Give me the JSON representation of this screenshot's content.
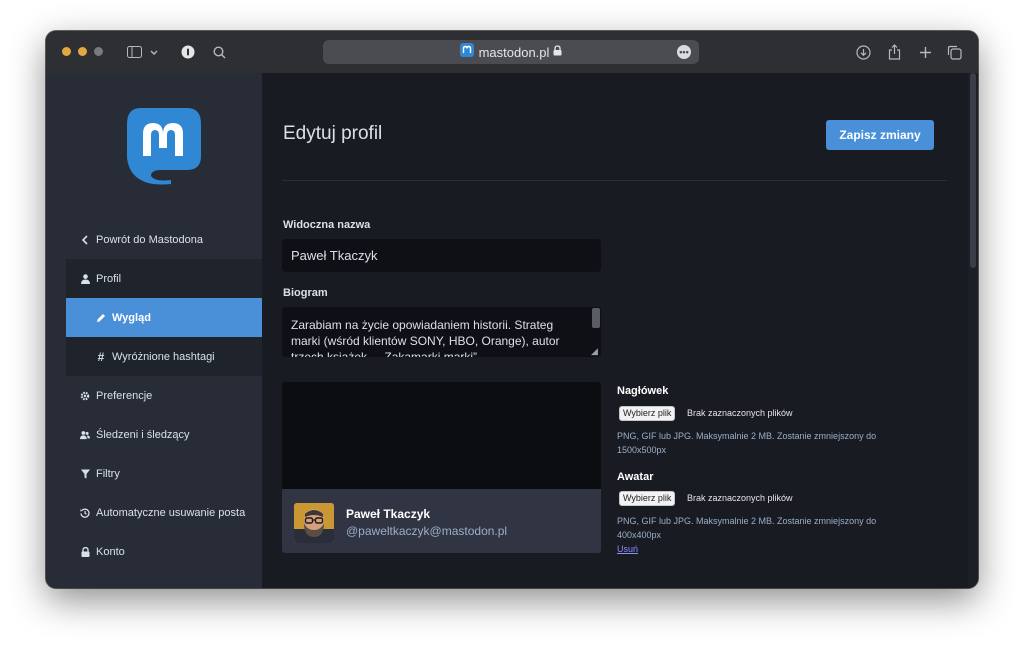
{
  "browser": {
    "url": "mastodon.pl",
    "icons": [
      "sidebar-toggle-icon",
      "chevron-down-icon",
      "password-manager-icon",
      "search-icon",
      "lock-icon",
      "more-icon",
      "download-icon",
      "share-icon",
      "new-tab-icon",
      "tabs-overview-icon"
    ]
  },
  "sidebar": {
    "back_label": "Powrót do Mastodona",
    "items": [
      {
        "label": "Profil",
        "icon": "person-icon"
      },
      {
        "label": "Wygląd",
        "icon": "pencil-icon",
        "active": true
      },
      {
        "label": "Wyróżnione hashtagi",
        "icon": "hashtag-icon"
      },
      {
        "label": "Preferencje",
        "icon": "gear-icon"
      },
      {
        "label": "Śledzeni i śledzący",
        "icon": "users-icon"
      },
      {
        "label": "Filtry",
        "icon": "filter-icon"
      },
      {
        "label": "Automatyczne usuwanie posta",
        "icon": "history-icon"
      },
      {
        "label": "Konto",
        "icon": "lock-icon"
      }
    ]
  },
  "main": {
    "title": "Edytuj profil",
    "save_label": "Zapisz zmiany",
    "display_name_label": "Widoczna nazwa",
    "display_name_value": "Paweł Tkaczyk",
    "bio_label": "Biogram",
    "bio_value": "Zarabiam na życie opowiadaniem historii. Strateg marki (wśród klientów SONY, HBO, Orange), autor trzech książek – „Zakamarki marki”",
    "preview": {
      "name": "Paweł Tkaczyk",
      "handle": "@paweltkaczyk@mastodon.pl"
    },
    "header_section": {
      "title": "Nagłówek",
      "button": "Wybierz plik",
      "status": "Brak zaznaczonych plików",
      "hint": "PNG, GIF lub JPG. Maksymalnie 2 MB. Zostanie zmniejszony do 1500x500px"
    },
    "avatar_section": {
      "title": "Awatar",
      "button": "Wybierz plik",
      "status": "Brak zaznaczonych plików",
      "hint": "PNG, GIF lub JPG. Maksymalnie 2 MB. Zostanie zmniejszony do 400x400px",
      "remove": "Usuń"
    }
  },
  "colors": {
    "accent": "#4a90d9",
    "sidebar_bg": "#282c37",
    "main_bg": "#191b22"
  }
}
